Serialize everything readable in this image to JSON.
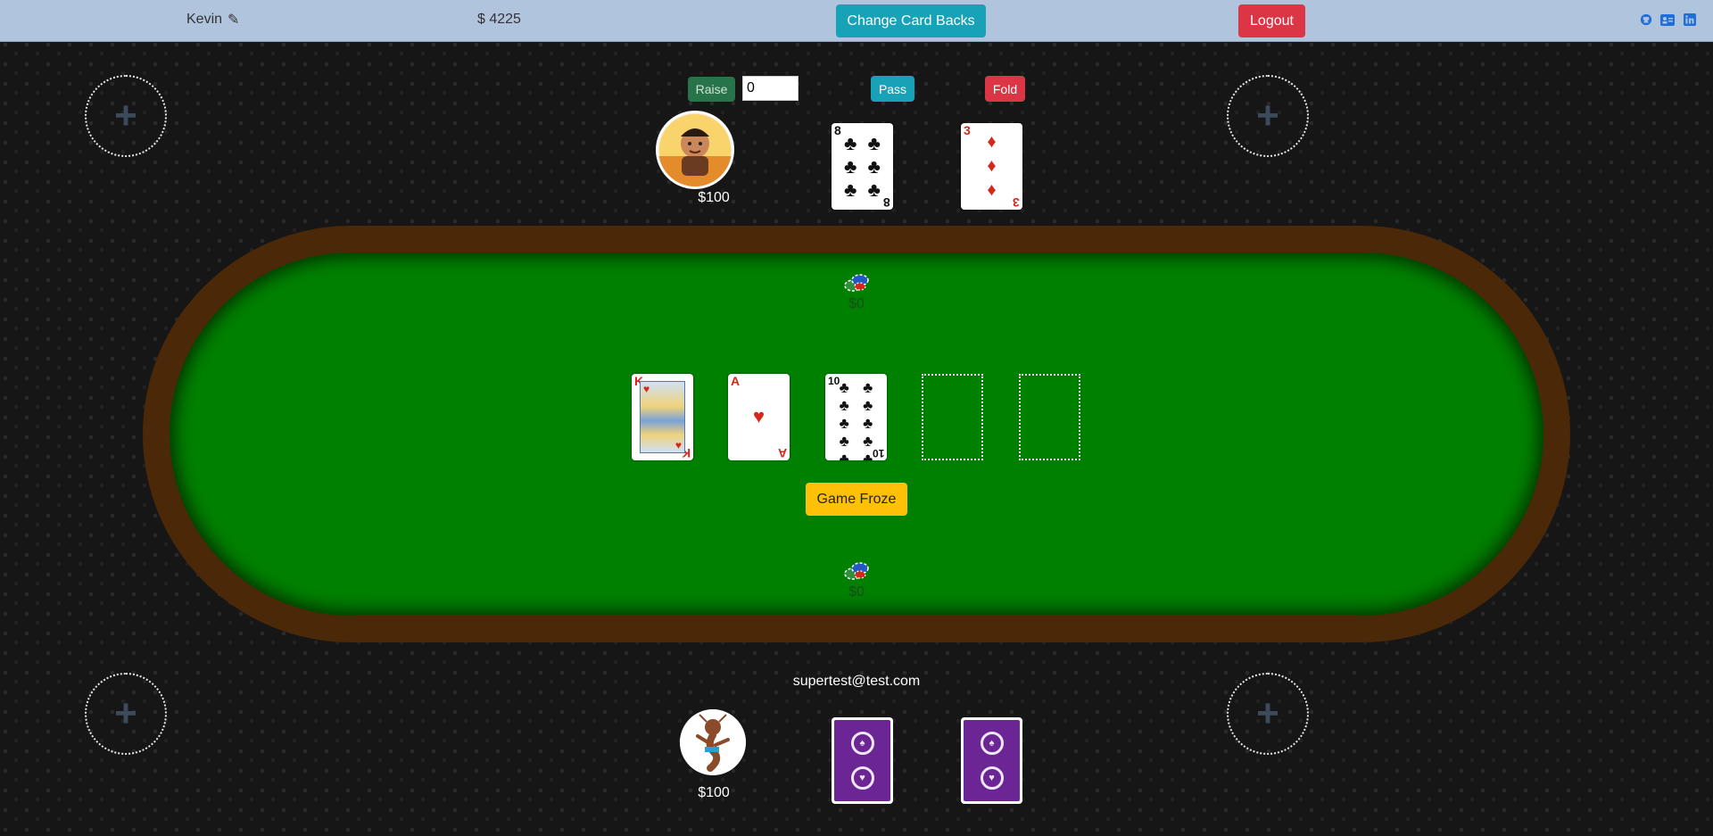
{
  "topbar": {
    "username": "Kevin",
    "balance": "$ 4225",
    "change_card_backs": "Change Card Backs",
    "logout": "Logout",
    "social_icons": [
      "github-icon",
      "contact-card-icon",
      "linkedin-icon"
    ],
    "colors": {
      "bar": "#b0c4de",
      "info": "#17a2b8",
      "danger": "#dc3545"
    }
  },
  "opponent": {
    "actions": {
      "raise": "Raise",
      "raise_value": "0",
      "pass": "Pass",
      "fold": "Fold"
    },
    "money": "$100",
    "cards": [
      {
        "rank": "8",
        "suit": "♣",
        "color": "black"
      },
      {
        "rank": "3",
        "suit": "♦",
        "color": "red"
      }
    ]
  },
  "table": {
    "top_pot": "$0",
    "bottom_pot": "$0",
    "community_cards": [
      {
        "rank": "K",
        "suit": "♥",
        "color": "red",
        "face": true
      },
      {
        "rank": "A",
        "suit": "♥",
        "color": "red"
      },
      {
        "rank": "10",
        "suit": "♣",
        "color": "black"
      }
    ],
    "empty_slots": 2,
    "game_froze": "Game Froze",
    "colors": {
      "felt": "#008000",
      "rim": "#4a2808"
    }
  },
  "player": {
    "email": "supertest@test.com",
    "money": "$100",
    "card_back_color": "#6b2594"
  },
  "empty_seat_symbol": "+"
}
